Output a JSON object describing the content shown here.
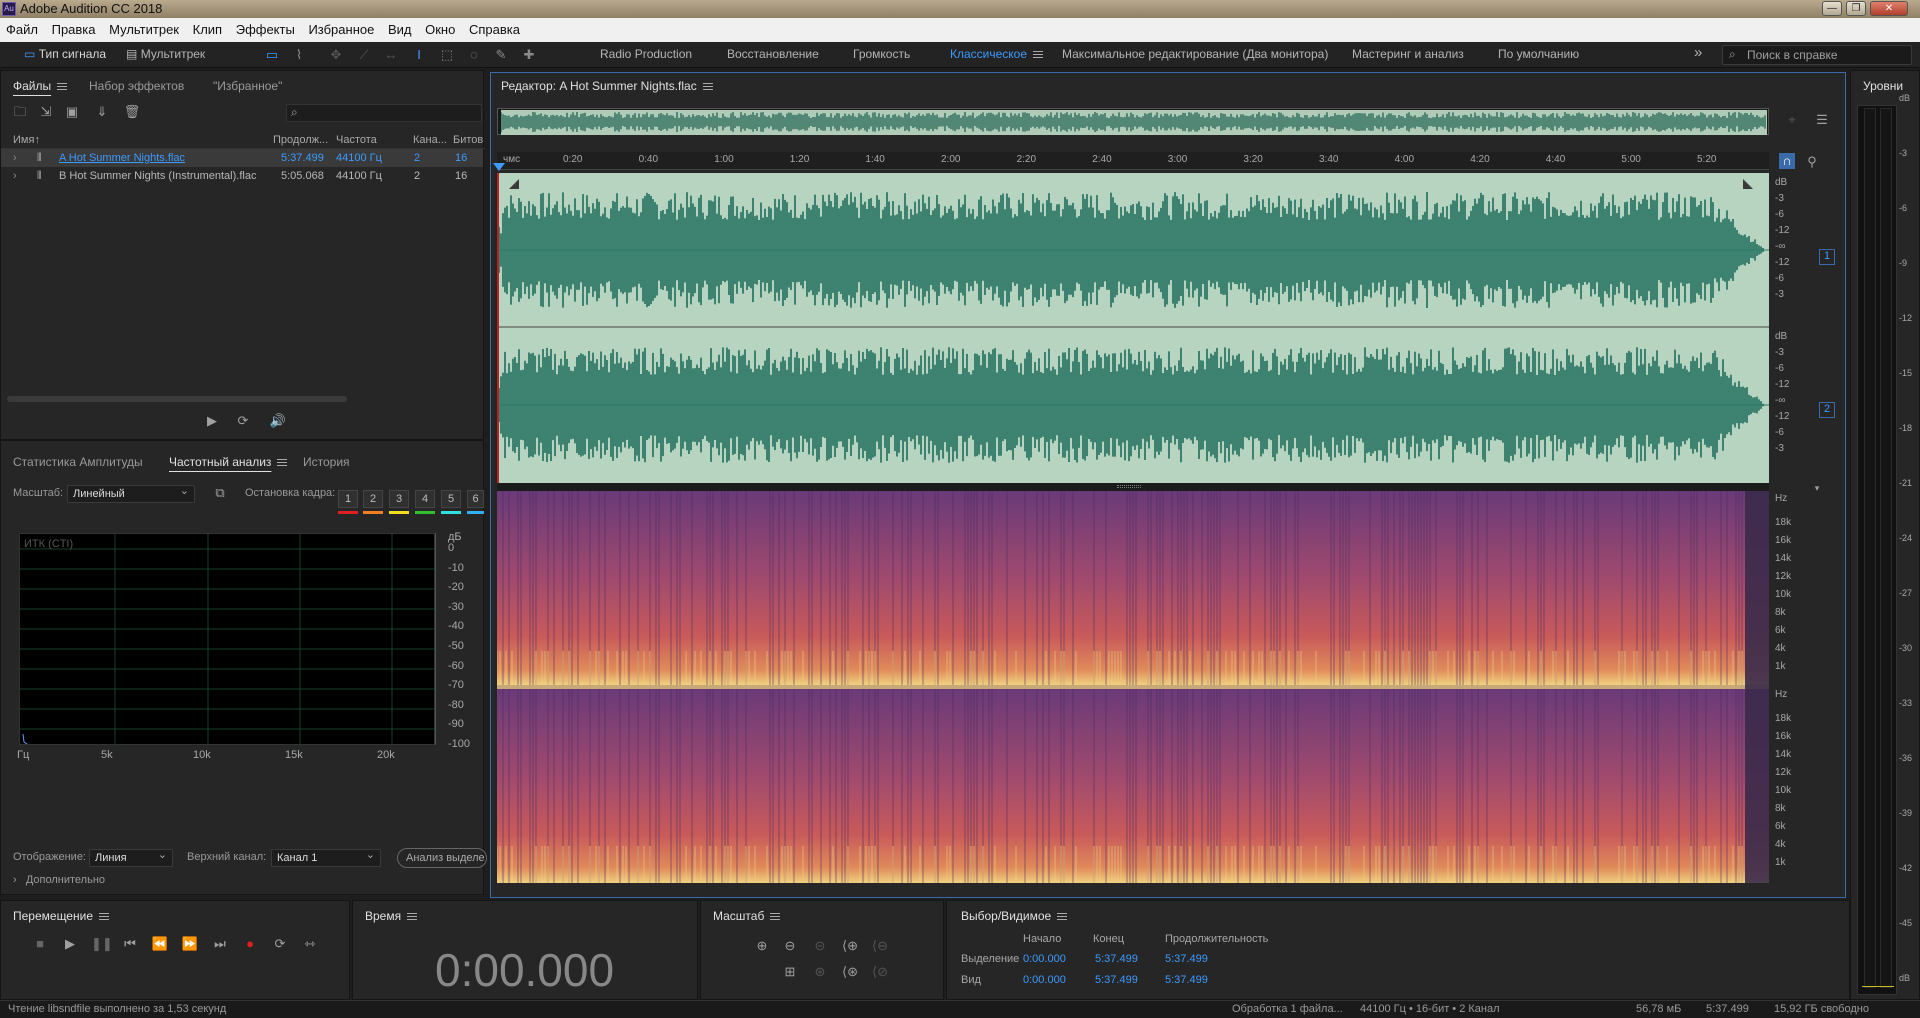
{
  "window": {
    "title": "Adobe Audition CC 2018",
    "app_icon": "Au"
  },
  "menu": [
    "Файл",
    "Правка",
    "Мультитрек",
    "Клип",
    "Эффекты",
    "Избранное",
    "Вид",
    "Окно",
    "Справка"
  ],
  "toolbar": {
    "waveform_mode": "Тип сигнала",
    "multitrack_mode": "Мультитрек",
    "workspaces": [
      "Radio Production",
      "Восстановление",
      "Громкость",
      "Классическое",
      "Максимальное редактирование (Два монитора)",
      "Мастеринг и анализ",
      "По умолчанию"
    ],
    "active_workspace": "Классическое",
    "search_placeholder": "Поиск в справке",
    "more": "»"
  },
  "files_panel": {
    "tabs": [
      "Файлы",
      "Набор эффектов",
      "\"Избранное\""
    ],
    "columns": [
      "Имя",
      "Продолж...",
      "Частота",
      "Кана...",
      "Битов"
    ],
    "sort_arrow": "↑",
    "search_icon": "⌕",
    "rows": [
      {
        "name": "A Hot Summer Nights.flac",
        "duration": "5:37.499",
        "rate": "44100 Гц",
        "channels": "2",
        "bits": "16",
        "selected": true
      },
      {
        "name": "B Hot Summer Nights (Instrumental).flac",
        "duration": "5:05.068",
        "rate": "44100 Гц",
        "channels": "2",
        "bits": "16",
        "selected": false
      }
    ]
  },
  "analysis_panel": {
    "tabs": [
      "Статистика Амплитуды",
      "Частотный анализ",
      "История"
    ],
    "scale_label": "Масштаб:",
    "scale_value": "Линейный",
    "freeze_label": "Остановка кадра:",
    "freeze_slots": [
      "1",
      "2",
      "3",
      "4",
      "5",
      "6"
    ],
    "slot_colors": [
      "#e02020",
      "#f08020",
      "#f0e020",
      "#30c030",
      "#30e0e0",
      "#30b0f0"
    ],
    "cti_label": "ИТК (CTI)",
    "db_unit": "дБ",
    "db_ticks": [
      "0",
      "-10",
      "-20",
      "-30",
      "-40",
      "-50",
      "-60",
      "-70",
      "-80",
      "-90",
      "-100"
    ],
    "hz_ticks": [
      "Гц",
      "5k",
      "10k",
      "15k",
      "20k"
    ],
    "display_label": "Отображение:",
    "display_value": "Линия",
    "top_channel_label": "Верхний канал:",
    "top_channel_value": "Канал 1",
    "analyze_button": "Анализ выделе",
    "advanced_label": "Дополнительно"
  },
  "editor": {
    "title": "Редактор: A Hot Summer Nights.flac",
    "time_unit": "чмс",
    "ruler": [
      "0:20",
      "0:40",
      "1:00",
      "1:20",
      "1:40",
      "2:00",
      "2:20",
      "2:40",
      "3:00",
      "3:20",
      "3:40",
      "4:00",
      "4:20",
      "4:40",
      "5:00",
      "5:20"
    ],
    "db_scale": [
      "dB",
      "-3",
      "-6",
      "-12",
      "-∞",
      "-12",
      "-6",
      "-3"
    ],
    "channels": [
      "1",
      "2"
    ],
    "hz_scale": [
      "Hz",
      "18k",
      "16k",
      "14k",
      "12k",
      "10k",
      "8k",
      "6k",
      "4k",
      "1k"
    ],
    "colors": {
      "wave_bg": "#b7d4c0",
      "wave_fg": "#1f6e5c",
      "spec_bg": "#7a3a6a",
      "spec_hot": "#f0d080"
    }
  },
  "levels_panel": {
    "title": "Уровни",
    "ticks": [
      "dB",
      "-3",
      "-6",
      "-9",
      "-12",
      "-15",
      "-18",
      "-21",
      "-24",
      "-27",
      "-30",
      "-33",
      "-36",
      "-39",
      "-42",
      "-45",
      "dB"
    ]
  },
  "transport": {
    "title": "Перемещение"
  },
  "time_panel": {
    "title": "Время",
    "value": "0:00.000"
  },
  "zoom_panel": {
    "title": "Масштаб"
  },
  "selection_panel": {
    "title": "Выбор/Видимое",
    "headers": [
      "Начало",
      "Конец",
      "Продолжительность"
    ],
    "rows": [
      {
        "label": "Выделение",
        "start": "0:00.000",
        "end": "5:37.499",
        "duration": "5:37.499"
      },
      {
        "label": "Вид",
        "start": "0:00.000",
        "end": "5:37.499",
        "duration": "5:37.499"
      }
    ]
  },
  "status": {
    "left": "Чтение libsndfile выполнено за 1,53 секунд",
    "processing": "Обработка 1 файла...",
    "format": "44100 Гц • 16-бит • 2 Канал",
    "size": "56,78 мБ",
    "duration": "5:37.499",
    "free": "15,92 ГБ свободно"
  }
}
